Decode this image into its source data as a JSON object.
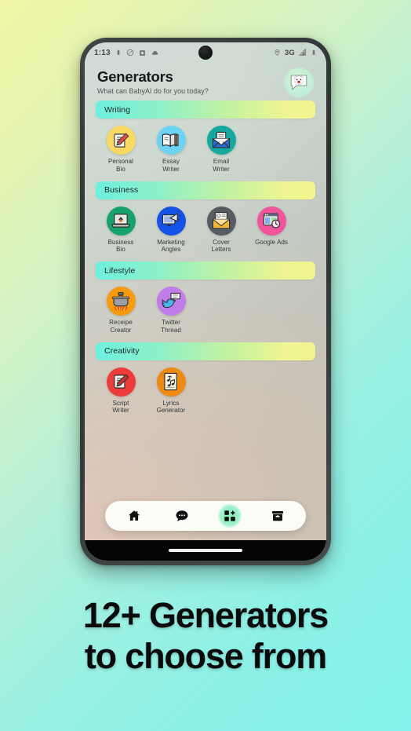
{
  "caption": {
    "line1": "12+ Generators",
    "line2": "to choose from"
  },
  "status_bar": {
    "time": "1:13",
    "network": "3G",
    "left_icons": [
      "battery-icon",
      "do-not-disturb-icon",
      "sd-card-icon",
      "cloud-icon"
    ],
    "right_icons": [
      "location-pin-icon",
      "signal-bars-icon",
      "battery-icon"
    ]
  },
  "header": {
    "title": "Generators",
    "subtitle": "What can BabyAI do for you today?",
    "avatar_name": "babyai-logo"
  },
  "categories": [
    {
      "name": "Writing",
      "items": [
        {
          "label_line1": "Personal",
          "label_line2": "Bio",
          "icon": "scroll-pencil-icon",
          "color": "#FAD961"
        },
        {
          "label_line1": "Essay",
          "label_line2": "Writer",
          "icon": "open-book-pencil-icon",
          "color": "#6DD3F5"
        },
        {
          "label_line1": "Email",
          "label_line2": "Writer",
          "icon": "envelope-document-icon",
          "color": "#14A8A0"
        }
      ]
    },
    {
      "name": "Business",
      "items": [
        {
          "label_line1": "Business",
          "label_line2": "Bio",
          "icon": "laptop-icon",
          "color": "#17A26B"
        },
        {
          "label_line1": "Marketing",
          "label_line2": "Angles",
          "icon": "monitor-megaphone-icon",
          "color": "#1552E8"
        },
        {
          "label_line1": "Cover",
          "label_line2": "Letters",
          "icon": "envelope-letter-icon",
          "color": "#585C60"
        },
        {
          "label_line1": "Google Ads",
          "label_line2": "",
          "icon": "browser-clock-icon",
          "color": "#F0559C"
        }
      ]
    },
    {
      "name": "Lifestyle",
      "items": [
        {
          "label_line1": "Receipe",
          "label_line2": "Creator",
          "icon": "cooking-pot-icon",
          "color": "#F89A0D"
        },
        {
          "label_line1": "Twitter",
          "label_line2": "Thread",
          "icon": "twitter-bird-icon",
          "color": "#C07CE8"
        }
      ]
    },
    {
      "name": "Creativity",
      "items": [
        {
          "label_line1": "Script",
          "label_line2": "Writer",
          "icon": "script-pencil-icon",
          "color": "#EE3B3B"
        },
        {
          "label_line1": "Lyrics",
          "label_line2": "Generator",
          "icon": "music-sheet-icon",
          "color": "#EE8A11"
        }
      ]
    }
  ],
  "bottom_nav": {
    "items": [
      {
        "name": "home",
        "icon": "home-icon",
        "active": false
      },
      {
        "name": "chat",
        "icon": "chat-bubble-icon",
        "active": false
      },
      {
        "name": "generators",
        "icon": "grid-icon",
        "active": true
      },
      {
        "name": "archive",
        "icon": "archive-box-icon",
        "active": false
      }
    ]
  },
  "colors": {
    "pill_gradient_start": "#6DF0DF",
    "pill_gradient_end": "#F3F58E",
    "page_gradient_start": "#F2F7A8",
    "page_gradient_end": "#84F2EA",
    "nav_active_glow": "#8EF0B6"
  }
}
